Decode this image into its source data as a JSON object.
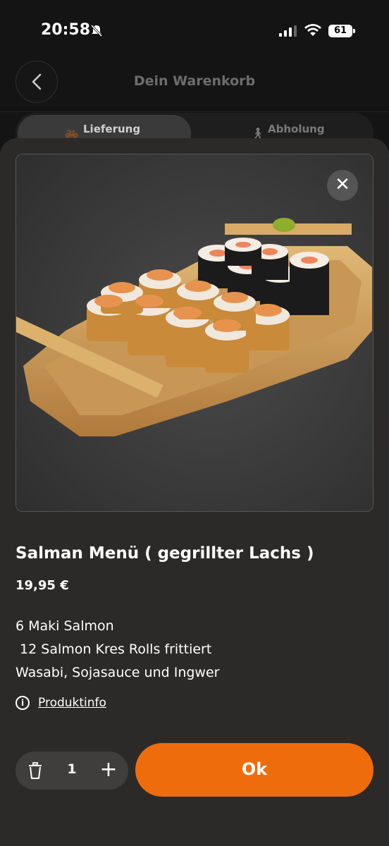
{
  "status_bar": {
    "time": "20:58",
    "battery": "61"
  },
  "header": {
    "title": "Dein Warenkorb"
  },
  "tabs": [
    {
      "label": "Lieferung",
      "icon": "bicycle-icon",
      "active": true
    },
    {
      "label": "Abholung",
      "icon": "pickup-icon",
      "active": false
    }
  ],
  "product": {
    "title": "Salman Menü ( gegrillter Lachs )",
    "price": "19,95 €",
    "description_lines": [
      "6 Maki Salmon",
      " 12 Salmon Kres Rolls frittiert",
      "Wasabi, Sojasauce und Ingwer"
    ],
    "info_link": "Produktinfo"
  },
  "quantity": {
    "value": "1"
  },
  "ok_button": {
    "label": "Ok"
  },
  "colors": {
    "accent": "#ef6c0c",
    "sheet": "#2b2a29",
    "background": "#141414"
  }
}
